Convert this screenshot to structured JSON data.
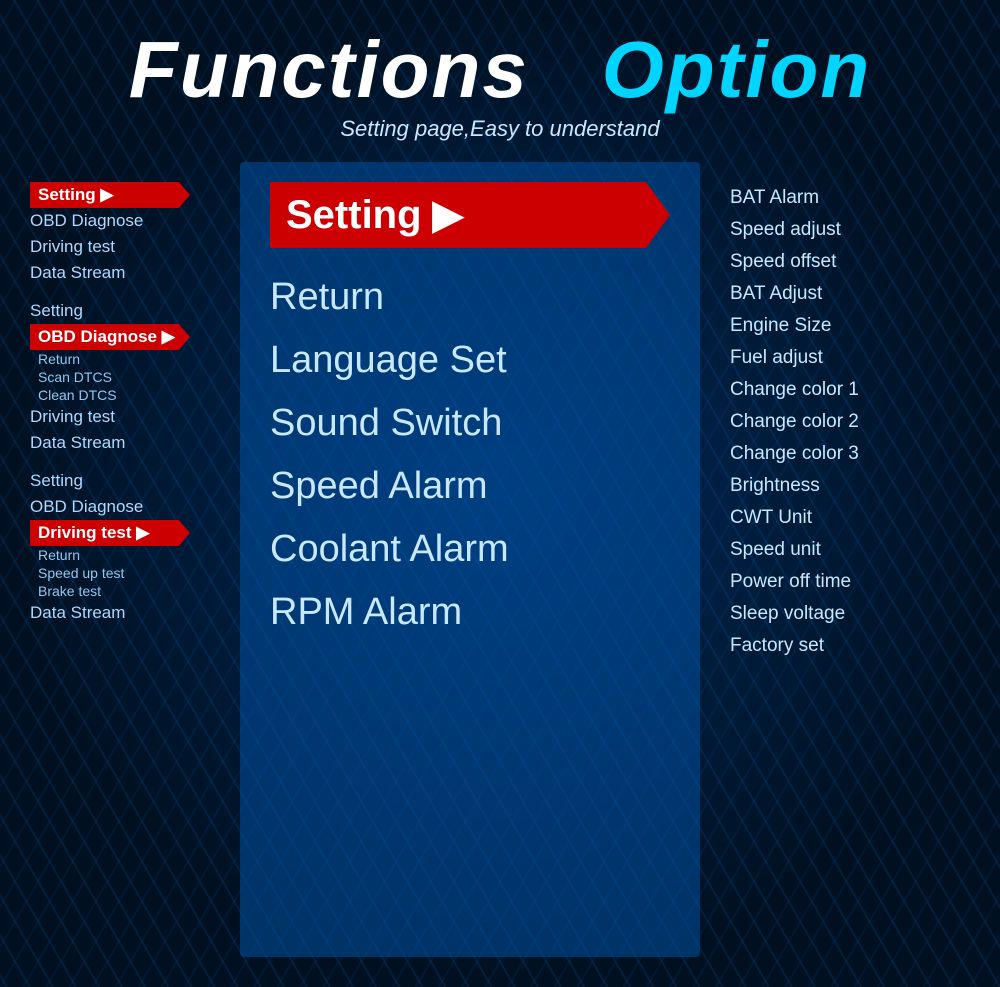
{
  "header": {
    "title_functions": "Functions",
    "title_option": "Option",
    "subtitle": "Setting page,Easy to understand"
  },
  "left_panel": {
    "groups": [
      {
        "items": [
          {
            "label": "Setting",
            "active": true,
            "sub": false
          },
          {
            "label": "OBD Diagnose",
            "active": false,
            "sub": false
          },
          {
            "label": "Driving test",
            "active": false,
            "sub": false
          },
          {
            "label": "Data Stream",
            "active": false,
            "sub": false
          }
        ]
      },
      {
        "items": [
          {
            "label": "Setting",
            "active": false,
            "sub": false
          },
          {
            "label": "OBD Diagnose",
            "active": true,
            "sub": false
          },
          {
            "label": "Return",
            "active": false,
            "sub": true
          },
          {
            "label": "Scan DTCS",
            "active": false,
            "sub": true
          },
          {
            "label": "Clean DTCS",
            "active": false,
            "sub": true
          },
          {
            "label": "Driving test",
            "active": false,
            "sub": false
          },
          {
            "label": "Data Stream",
            "active": false,
            "sub": false
          }
        ]
      },
      {
        "items": [
          {
            "label": "Setting",
            "active": false,
            "sub": false
          },
          {
            "label": "OBD Diagnose",
            "active": false,
            "sub": false
          },
          {
            "label": "Driving test",
            "active": true,
            "sub": false
          },
          {
            "label": "Return",
            "active": false,
            "sub": true
          },
          {
            "label": "Speed up test",
            "active": false,
            "sub": true
          },
          {
            "label": "Brake test",
            "active": false,
            "sub": true
          },
          {
            "label": "Data Stream",
            "active": false,
            "sub": false
          }
        ]
      }
    ]
  },
  "middle_panel": {
    "selected": "Setting",
    "items": [
      "Return",
      "Language Set",
      "Sound Switch",
      "Speed Alarm",
      "Coolant Alarm",
      "RPM Alarm"
    ]
  },
  "right_panel": {
    "items": [
      "BAT Alarm",
      "Speed adjust",
      "Speed offset",
      "BAT Adjust",
      "Engine Size",
      "Fuel adjust",
      "Change color 1",
      "Change color 2",
      "Change color 3",
      "Brightness",
      "CWT Unit",
      "Speed unit",
      "Power off time",
      "Sleep voltage",
      "Factory set"
    ]
  }
}
